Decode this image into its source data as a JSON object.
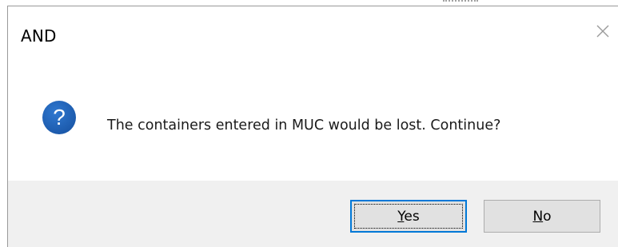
{
  "dialog": {
    "title": "AND",
    "message": "The containers entered in MUC would be lost. Continue?",
    "icon": "question-icon",
    "buttons": {
      "yes": {
        "mnemonic": "Y",
        "rest": "es"
      },
      "no": {
        "mnemonic": "N",
        "rest": "o"
      }
    },
    "default_button": "yes"
  },
  "colors": {
    "icon_blue": "#1f5fb4",
    "focus_border": "#0078d7",
    "button_face": "#e1e1e1",
    "button_bar": "#f0f0f0"
  }
}
